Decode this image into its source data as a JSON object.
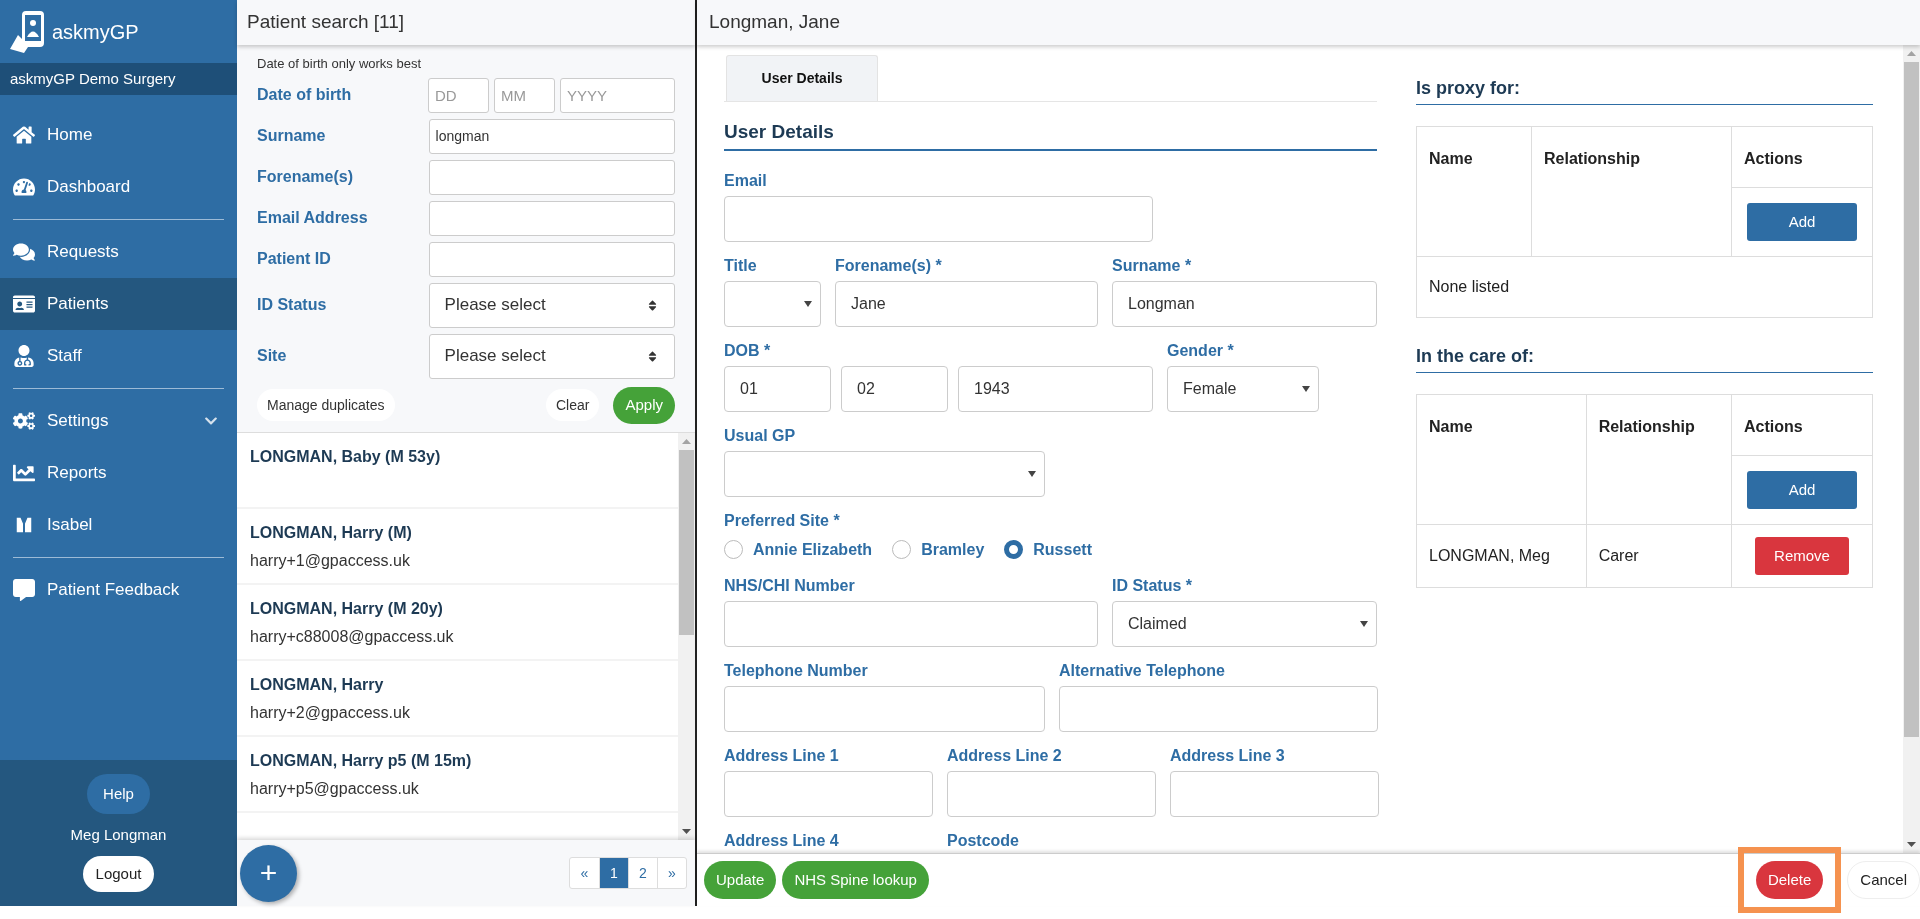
{
  "sidebar": {
    "logo_text": "askmyGP",
    "practice": "askmyGP Demo Surgery",
    "groups": [
      [
        {
          "label": "Home",
          "selected": false,
          "submenu": false
        },
        {
          "label": "Dashboard",
          "selected": false,
          "submenu": false
        }
      ],
      [
        {
          "label": "Requests",
          "selected": false,
          "submenu": false
        },
        {
          "label": "Patients",
          "selected": true,
          "submenu": false
        },
        {
          "label": "Staff",
          "selected": false,
          "submenu": false
        }
      ],
      [
        {
          "label": "Settings",
          "selected": false,
          "submenu": true
        },
        {
          "label": "Reports",
          "selected": false,
          "submenu": false
        },
        {
          "label": "Isabel",
          "selected": false,
          "submenu": false
        }
      ],
      [
        {
          "label": "Patient Feedback",
          "selected": false,
          "submenu": false
        }
      ]
    ],
    "help": "Help",
    "user": "Meg Longman",
    "logout": "Logout"
  },
  "search": {
    "title": "Patient search [11]",
    "hint": "Date of birth only works best",
    "fields": [
      {
        "kind": "date",
        "label": "Date of birth",
        "parts": [
          {
            "placeholder": "DD"
          },
          {
            "placeholder": "MM"
          },
          {
            "placeholder": "YYYY"
          }
        ]
      },
      {
        "kind": "text",
        "label": "Surname",
        "value": "longman"
      },
      {
        "kind": "text",
        "label": "Forename(s)"
      },
      {
        "kind": "text",
        "label": "Email Address"
      },
      {
        "kind": "text",
        "label": "Patient ID"
      },
      {
        "kind": "select",
        "label": "ID Status",
        "value": "Please select"
      },
      {
        "kind": "select",
        "label": "Site",
        "value": "Please select"
      }
    ],
    "manage": "Manage duplicates",
    "clear": "Clear",
    "apply": "Apply",
    "results": [
      {
        "name": "LONGMAN, Baby (M 53y)"
      },
      {
        "name": "LONGMAN, Harry (M)",
        "email": "harry+1@gpaccess.uk"
      },
      {
        "name": "LONGMAN, Harry (M 20y)",
        "email": "harry+c88008@gpaccess.uk"
      },
      {
        "name": "LONGMAN, Harry",
        "email": "harry+2@gpaccess.uk"
      },
      {
        "name": "LONGMAN, Harry p5 (M 15m)",
        "email": "harry+p5@gpaccess.uk"
      }
    ],
    "add": "+",
    "pages": [
      {
        "label": "«",
        "selected": false
      },
      {
        "label": "1",
        "selected": true
      },
      {
        "label": "2",
        "selected": false
      },
      {
        "label": "»",
        "selected": false
      }
    ]
  },
  "patient": {
    "title": "Longman, Jane",
    "tabs": [
      {
        "label": "User Details",
        "selected": true
      }
    ],
    "heading": "User Details",
    "rows": [
      [
        {
          "kind": "text",
          "label": "Email"
        }
      ],
      [
        {
          "kind": "select",
          "label": "Title"
        },
        {
          "kind": "text",
          "label": "Forename(s) *",
          "value": "Jane"
        },
        {
          "kind": "text",
          "label": "Surname *",
          "value": "Longman"
        }
      ],
      [
        {
          "kind": "date",
          "label": "DOB *",
          "parts": [
            {
              "value": "01"
            },
            {
              "value": "02"
            },
            {
              "value": "1943"
            }
          ]
        },
        {
          "kind": "select",
          "label": "Gender *",
          "value": "Female"
        }
      ],
      [
        {
          "kind": "select",
          "label": "Usual GP"
        }
      ],
      [
        {
          "kind": "radio",
          "label": "Preferred Site *",
          "options": [
            {
              "label": "Annie Elizabeth",
              "selected": false
            },
            {
              "label": "Bramley",
              "selected": false
            },
            {
              "label": "Russett",
              "selected": true
            }
          ]
        }
      ],
      [
        {
          "kind": "text",
          "label": "NHS/CHI Number"
        },
        {
          "kind": "select",
          "label": "ID Status *",
          "value": "Claimed"
        }
      ],
      [
        {
          "kind": "text",
          "label": "Telephone Number"
        },
        {
          "kind": "text",
          "label": "Alternative Telephone"
        }
      ],
      [
        {
          "kind": "text",
          "label": "Address Line 1"
        },
        {
          "kind": "text",
          "label": "Address Line 2"
        },
        {
          "kind": "text",
          "label": "Address Line 3"
        }
      ],
      [
        {
          "kind": "hidden",
          "label": "Address Line 4"
        },
        {
          "kind": "hidden",
          "label": "Postcode"
        }
      ]
    ],
    "proxy": {
      "title": "Is proxy for:",
      "columns": [
        "Name",
        "Relationship",
        "Actions"
      ],
      "add": "Add",
      "empty": "None listed"
    },
    "care": {
      "title": "In the care of:",
      "columns": [
        "Name",
        "Relationship",
        "Actions"
      ],
      "add": "Add",
      "rows": [
        {
          "name": "LONGMAN, Meg",
          "relationship": "Carer",
          "action": "Remove"
        }
      ]
    },
    "actions": [
      {
        "label": "Update",
        "kind": "success",
        "highlighted": false
      },
      {
        "label": "NHS Spine lookup",
        "kind": "success",
        "highlighted": false
      }
    ],
    "end_actions": [
      {
        "label": "Delete",
        "kind": "danger",
        "highlighted": true
      },
      {
        "label": "Cancel",
        "kind": "plain",
        "highlighted": false
      }
    ]
  }
}
